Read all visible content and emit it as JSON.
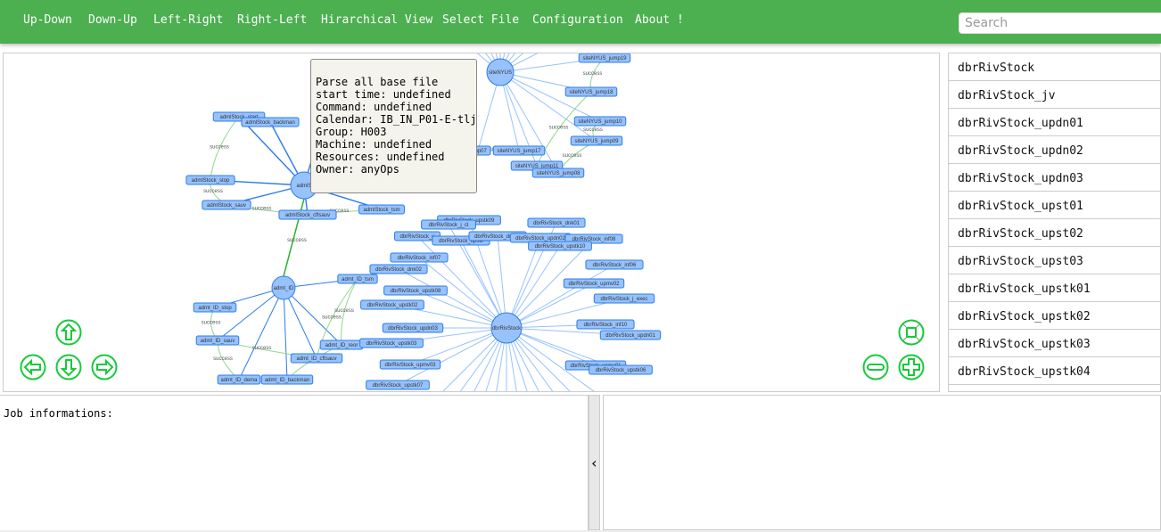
{
  "nav": {
    "items": [
      "Up-Down",
      "Down-Up",
      "Left-Right",
      "Right-Left",
      "Hirarchical View",
      "Select File",
      "Configuration",
      "About !"
    ],
    "search_placeholder": "Search"
  },
  "colors": {
    "nav": "#4caf50",
    "node": "#97c2fc",
    "node_border": "#2b7ce9",
    "edge": "#2b7ce9",
    "success_edge": "#2bb42b",
    "control": "#19c93b"
  },
  "graph": {
    "success_label": "success",
    "hubs": [
      "siteNYUS",
      "admlS",
      "admt_ID",
      "dbrRivStock"
    ],
    "nodes": [
      "siteNYUS_jump19",
      "siteNYUS_jump18",
      "siteNYUS_jump10",
      "siteNYUS_jump09",
      "siteNYUS_jump17",
      "siteNYUS_jump11",
      "siteNYUS_jump08",
      "jump07",
      "admlStock_start",
      "admlStock_backman",
      "admlStock_stop",
      "admlStock_sauv",
      "admlStock_cftsauv",
      "admlStock_tsm",
      "adml",
      "admt_ID_tsm",
      "admt_ID_stop",
      "admt_ID_sauv",
      "admt_ID_reor",
      "admt_ID_cftsauv",
      "admt_ID_dema",
      "admt_ID_backman",
      "dbrRivStock_upstk09",
      "dbrRivStock_j_cl",
      "dbrRivStock_dnk01",
      "dbrRivStock_u",
      "dbrRivStock_upstk",
      "dbrRivStock_dnk03",
      "dbrRivStock_updn02",
      "dbrRivStock_inf08",
      "dbrRivStock_upstk10",
      "dbrRivStock_inf07",
      "dbrRivStock_dnk02",
      "dbrRivStock_inf06",
      "dbrRivStock_upstk08",
      "dbrRivStock_upmv02",
      "dbrRivStock_upstk02",
      "dbrRivStock_j_exec",
      "dbrRivStock_updn03",
      "dbrRivStock_inf10",
      "dbrRivStock_updn01",
      "dbrRivStock_upstk03",
      "dbrRivStock_upmv03",
      "dbrRivStock_upmv01",
      "dbrRivStock_upstk06",
      "dbrRivStock_upstk07"
    ]
  },
  "tooltip": {
    "lines": [
      "Parse all base file",
      "start time: undefined",
      "Command: undefined",
      "Calendar: IB_IN_P01-E-tlj",
      "Group: H003",
      "Machine: undefined",
      "Resources: undefined",
      "Owner: anyOps"
    ]
  },
  "controls": {
    "up": "arrow-up-icon",
    "left": "arrow-left-icon",
    "down": "arrow-down-icon",
    "right": "arrow-right-icon",
    "fit": "fit-icon",
    "zoom_out": "minus-icon",
    "zoom_in": "plus-icon"
  },
  "job_list": [
    "dbrRivStock",
    "dbrRivStock_jv",
    "dbrRivStock_updn01",
    "dbrRivStock_updn02",
    "dbrRivStock_updn03",
    "dbrRivStock_upst01",
    "dbrRivStock_upst02",
    "dbrRivStock_upst03",
    "dbrRivStock_upstk01",
    "dbrRivStock_upstk02",
    "dbrRivStock_upstk03",
    "dbrRivStock_upstk04"
  ],
  "info": {
    "label": "Job informations:"
  },
  "handle": {
    "glyph": "‹"
  }
}
